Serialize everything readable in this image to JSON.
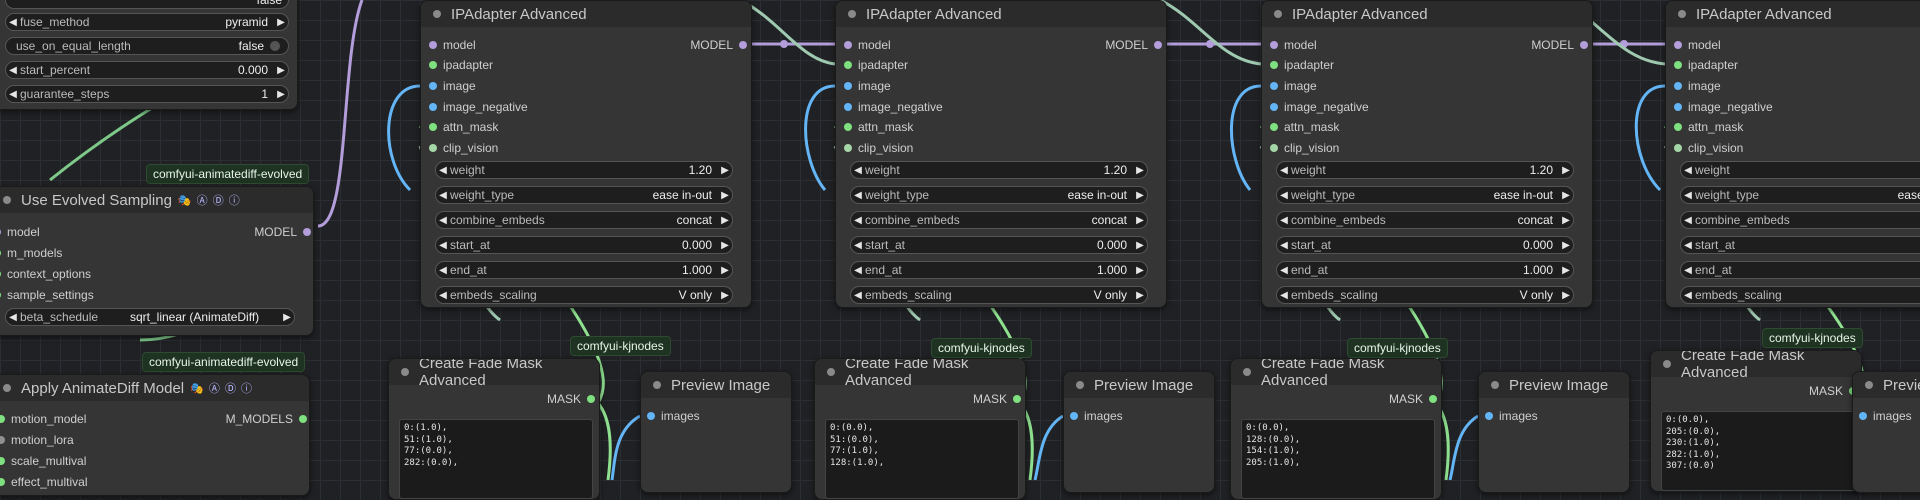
{
  "top_left_node": {
    "partial_top": "false",
    "widgets": [
      {
        "label": "fuse_method",
        "value": "pyramid",
        "kind": "combo"
      },
      {
        "label": "use_on_equal_length",
        "value": "false",
        "kind": "toggle"
      },
      {
        "label": "start_percent",
        "value": "0.000",
        "kind": "number"
      },
      {
        "label": "guarantee_steps",
        "value": "1",
        "kind": "number"
      }
    ]
  },
  "use_evolved": {
    "tag": "comfyui-animatediff-evolved",
    "title": "Use Evolved Sampling",
    "badges": "🎭 Ⓐ Ⓓ ⓘ",
    "inputs": [
      "model",
      "m_models",
      "context_options",
      "sample_settings"
    ],
    "output": "MODEL",
    "widget": {
      "label": "beta_schedule",
      "value": "sqrt_linear (AnimateDiff)"
    }
  },
  "apply_animatediff": {
    "tag": "comfyui-animatediff-evolved",
    "title": "Apply AnimateDiff Model",
    "badges": "🎭 Ⓐ Ⓓ ⓘ",
    "inputs": [
      "motion_model",
      "motion_lora",
      "scale_multival",
      "effect_multival"
    ],
    "output": "M_MODELS"
  },
  "ipadapter": {
    "title": "IPAdapter Advanced",
    "inputs": [
      "model",
      "ipadapter",
      "image",
      "image_negative",
      "attn_mask",
      "clip_vision"
    ],
    "output": "MODEL",
    "widgets": [
      {
        "label": "weight",
        "value": "1.20"
      },
      {
        "label": "weight_type",
        "value": "ease in-out"
      },
      {
        "label": "combine_embeds",
        "value": "concat"
      },
      {
        "label": "start_at",
        "value": "0.000"
      },
      {
        "label": "end_at",
        "value": "1.000"
      },
      {
        "label": "embeds_scaling",
        "value": "V only"
      }
    ]
  },
  "fade_mask": {
    "tag": "comfyui-kjnodes",
    "title": "Create Fade Mask Advanced",
    "output": "MASK",
    "texts": [
      "0:(1.0),\n51:(1.0),\n77:(0.0),\n282:(0.0),",
      "0:(0.0),\n51:(0.0),\n77:(1.0),\n128:(1.0),",
      "0:(0.0),\n128:(0.0),\n154:(1.0),\n205:(1.0),",
      "0:(0.0),\n205:(0.0),\n230:(1.0),\n282:(1.0),\n307:(0.0)"
    ]
  },
  "preview": {
    "title": "Preview Image",
    "input": "images"
  },
  "colors": {
    "wire_model": "#b39ddb",
    "wire_image": "#64b5f6",
    "wire_mask": "#8fe08f",
    "wire_green": "#7ec98a",
    "wire_teal": "#9fc9b0"
  }
}
